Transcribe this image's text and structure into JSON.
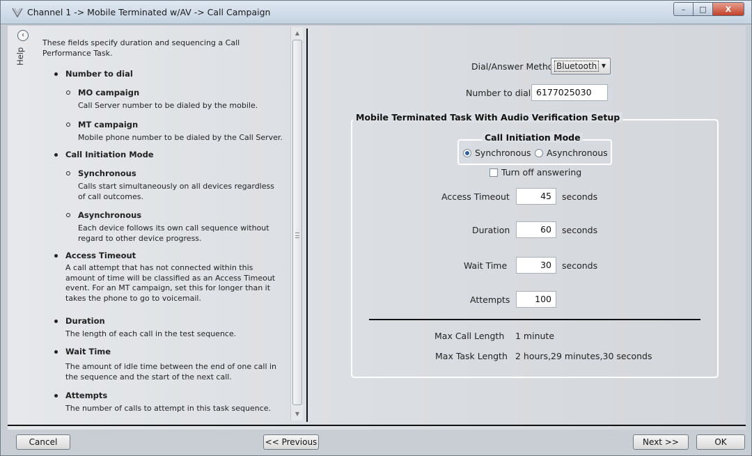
{
  "window": {
    "title": "Channel 1 -> Mobile Terminated w/AV -> Call Campaign",
    "controls": {
      "minimize": "–",
      "maximize": "□",
      "close": "X"
    }
  },
  "help": {
    "rail_label": "Help",
    "back_glyph": "‹",
    "intro": "These fields specify duration and sequencing a Call Performance Task.",
    "number_to_dial": {
      "heading": "Number to dial",
      "mo_heading": "MO campaign",
      "mo_text": "Call Server number to be dialed by the mobile.",
      "mt_heading": "MT campaign",
      "mt_text": "Mobile phone number to be dialed by the Call Server."
    },
    "call_initiation": {
      "heading": "Call Initiation Mode",
      "sync_heading": "Synchronous",
      "sync_text": "Calls start simultaneously on all devices regardless of call outcomes.",
      "async_heading": "Asynchronous",
      "async_text": "Each device follows its own call sequence without regard to other device progress."
    },
    "access_timeout": {
      "heading": "Access Timeout",
      "text": "A call attempt that has not connected within this amount of time will be classified as an Access Timeout event.  For an MT campaign, set this for longer than it takes the phone to go to voicemail."
    },
    "duration": {
      "heading": "Duration",
      "text": "The length of each call in the test sequence."
    },
    "wait_time": {
      "heading": "Wait Time",
      "text": "The amount of idle time between the end of one call in the sequence and the start of the next call."
    },
    "attempts": {
      "heading": "Attempts",
      "text": "The number of calls to attempt in this task sequence."
    }
  },
  "form": {
    "dial_method_label": "Dial/Answer Method:",
    "dial_method_value": "Bluetooth",
    "number_label": "Number to dial",
    "number_value": "6177025030",
    "group_title": "Mobile Terminated Task With Audio Verification Setup",
    "cim_title": "Call Initiation Mode",
    "sync_label": "Synchronous",
    "async_label": "Asynchronous",
    "selected_mode": "Synchronous",
    "turn_off_answering_label": "Turn off answering",
    "turn_off_answering_checked": false,
    "access_timeout_label": "Access Timeout",
    "access_timeout_value": "45",
    "duration_label": "Duration",
    "duration_value": "60",
    "wait_time_label": "Wait Time",
    "wait_time_value": "30",
    "attempts_label": "Attempts",
    "attempts_value": "100",
    "unit_seconds": "seconds",
    "max_call_length_label": "Max Call Length",
    "max_call_length_value": "1 minute",
    "max_task_length_label": "Max Task Length",
    "max_task_length_value": "2 hours,29 minutes,30 seconds"
  },
  "buttons": {
    "cancel": "Cancel",
    "previous": "<< Previous",
    "next": "Next >>",
    "ok": "OK"
  }
}
